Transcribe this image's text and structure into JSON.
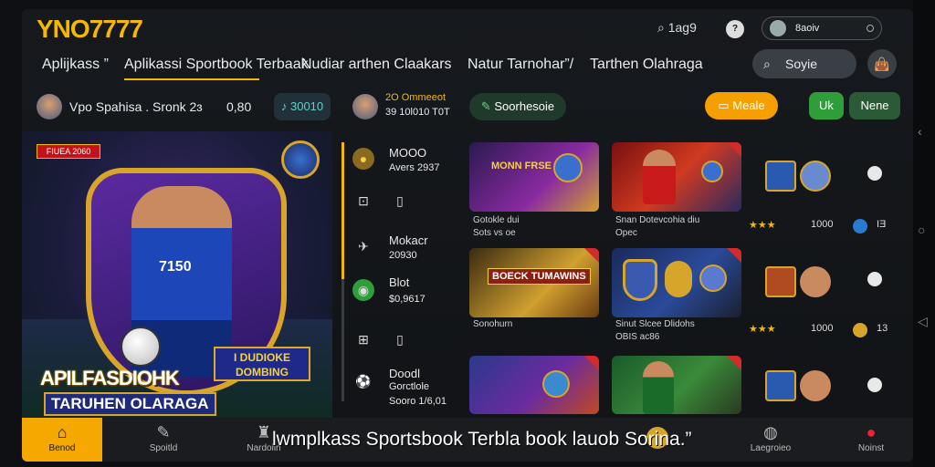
{
  "header": {
    "logo_main": "YNO",
    "logo_accent": "7777",
    "search_label": "1ag9",
    "help_icon_text": "?",
    "account_label": "8aoiv"
  },
  "nav": {
    "items": [
      {
        "label": "Aplijkass ”"
      },
      {
        "label": "Aplikassi Sportbook Terbaak"
      },
      {
        "label": "Nudiar arthen Claakars"
      },
      {
        "label": "Natur Tarnohar”/"
      },
      {
        "label": "Tarthen Olahraga"
      }
    ],
    "search_button": "Soyie"
  },
  "row2": {
    "user_name": "Vpo Spahisa . Sronk 2ɜ",
    "user_value": "0,80",
    "coin_value": "30010",
    "promo_line1": "2O Ommeeot",
    "promo_line2": "39 10l010 T0T",
    "sport_pill": "Soorhesoie",
    "media_button": "Meale",
    "uk_button": "Uk",
    "none_button": "Nene"
  },
  "hero": {
    "badge": "FIUEA 2060",
    "jersey": "7150",
    "title1": "APILFASDIOHK",
    "title2": "TARUHEN OLARAGA",
    "logo_line1": "I DUDIOKE",
    "logo_line2": "DOMBING"
  },
  "midlist": {
    "items": [
      {
        "title": "MOOO",
        "sub": "Avers 2937"
      },
      {
        "title": "",
        "sub": ""
      },
      {
        "title": "Mokacr",
        "sub": "20930"
      },
      {
        "title": "Blot",
        "sub": "$0,9617"
      },
      {
        "title": "",
        "sub": ""
      },
      {
        "title": "Doodl",
        "sub": "Gorctlole"
      },
      {
        "title": "",
        "sub": "Sooro 1/6,01"
      }
    ]
  },
  "cards": [
    {
      "label1": "Gotokle dui",
      "label2": "Sots vs oe"
    },
    {
      "label1": "Snan Dotevcohia diu",
      "label2": "Opec"
    },
    {
      "label1": "Sonohurn",
      "label2": ""
    },
    {
      "label1": "Sinut Slcee Dlidohs",
      "label2": "OBIS ac86"
    },
    {
      "label1": "",
      "label2": ""
    },
    {
      "label1": "",
      "label2": ""
    }
  ],
  "card_banners": {
    "c1": "MONN FRSE",
    "c3": "BOECK TUMAWINS"
  },
  "side": {
    "row1_stat": "1000",
    "row1_end": "IƎ",
    "row2_stat": "1000",
    "row2_end": "13"
  },
  "bottomnav": {
    "items": [
      {
        "label": "Benod"
      },
      {
        "label": "Spoitld"
      },
      {
        "label": "Nardoiin"
      },
      {
        "label": "Laegroieo"
      },
      {
        "label": "Noinst"
      }
    ]
  },
  "caption": "lwmplkass Sportsbook Terbla book lauob Sorina.”",
  "colors": {
    "accent": "#f5b800",
    "green": "#2f9e3a",
    "orange": "#f5a000"
  }
}
